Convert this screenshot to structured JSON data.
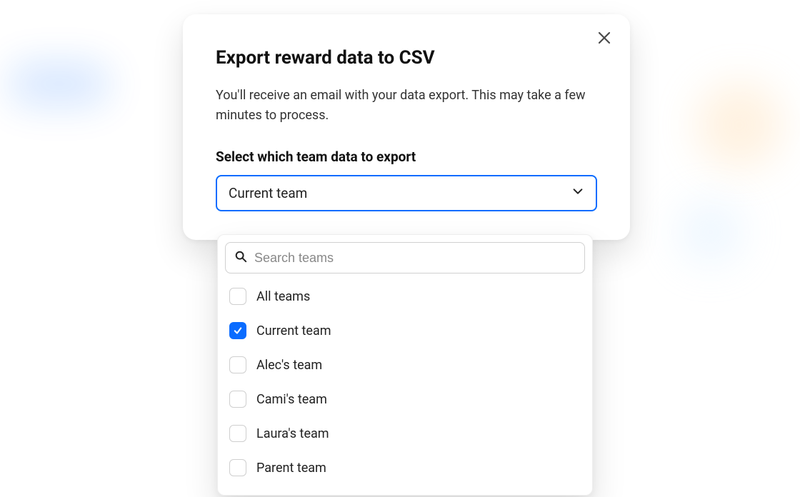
{
  "modal": {
    "title": "Export reward data to CSV",
    "description": "You'll receive an email with your data export. This may take a few minutes to process.",
    "section_label": "Select which team data to export",
    "select_value": "Current team"
  },
  "dropdown": {
    "search_placeholder": "Search teams",
    "options": [
      {
        "label": "All teams",
        "checked": false
      },
      {
        "label": "Current team",
        "checked": true
      },
      {
        "label": "Alec's team",
        "checked": false
      },
      {
        "label": "Cami's team",
        "checked": false
      },
      {
        "label": "Laura's team",
        "checked": false
      },
      {
        "label": "Parent team",
        "checked": false
      }
    ]
  },
  "colors": {
    "accent": "#0a6cff"
  }
}
